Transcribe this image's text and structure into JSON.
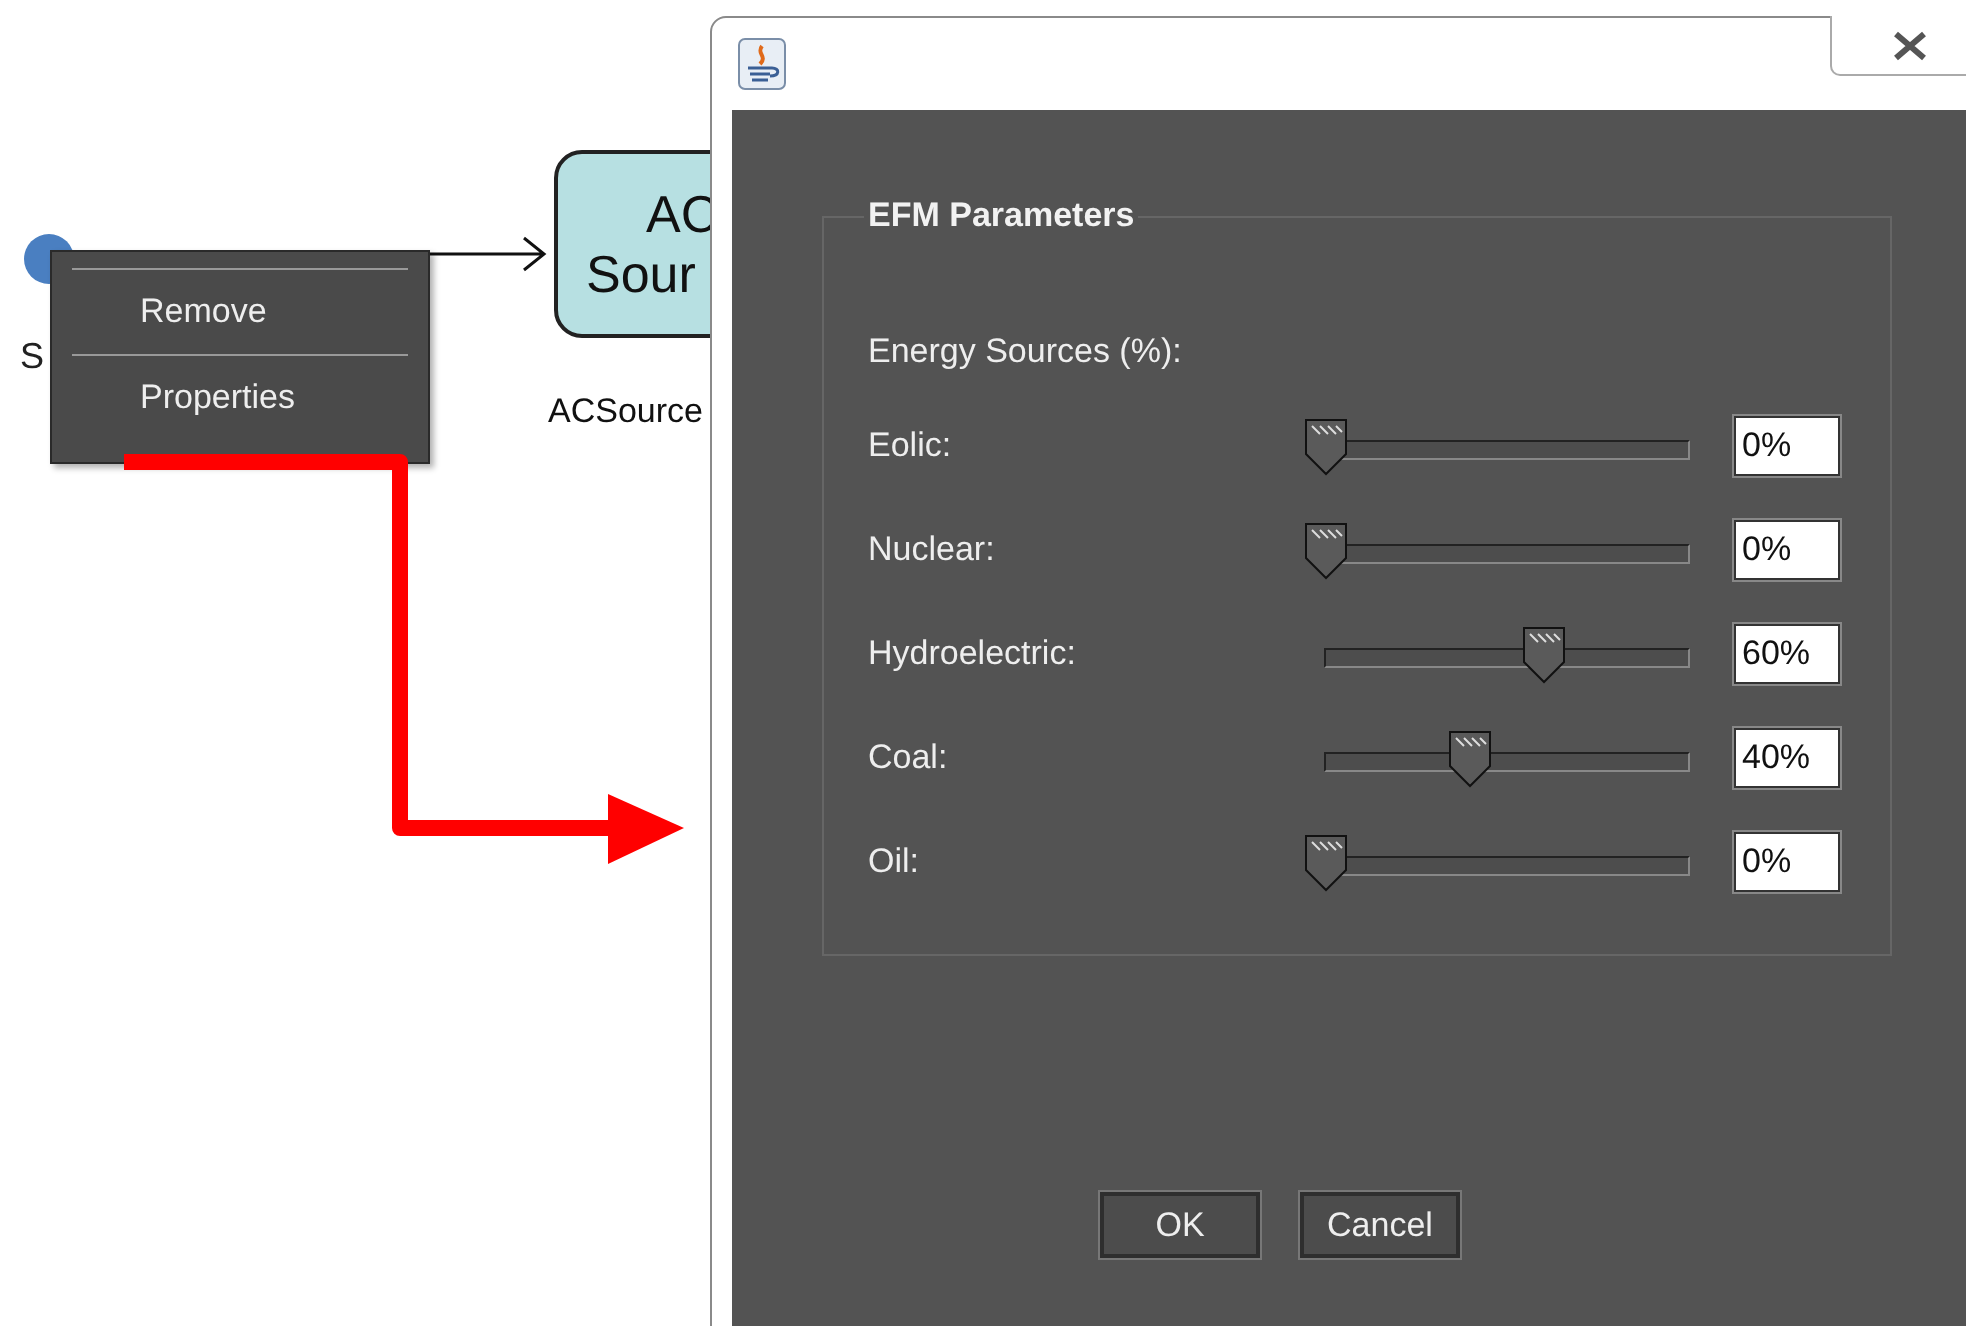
{
  "canvas": {
    "node_label": "S",
    "context_menu": {
      "items": [
        {
          "label": "Remove"
        },
        {
          "label": "Properties"
        }
      ]
    },
    "block": {
      "lines": [
        "AC",
        "Sour"
      ]
    },
    "block_label": "ACSource"
  },
  "dialog": {
    "group_title": "EFM Parameters",
    "section_label": "Energy Sources (%):",
    "sources": [
      {
        "name": "Eolic:",
        "level": 0,
        "value": "0%"
      },
      {
        "name": "Nuclear:",
        "level": 0,
        "value": "0%"
      },
      {
        "name": "Hydroelectric:",
        "level": 0.6,
        "value": "60%"
      },
      {
        "name": "Coal:",
        "level": 0.4,
        "value": "40%"
      },
      {
        "name": "Oil:",
        "level": 0,
        "value": "0%"
      }
    ],
    "buttons": [
      "OK",
      "Cancel"
    ]
  }
}
